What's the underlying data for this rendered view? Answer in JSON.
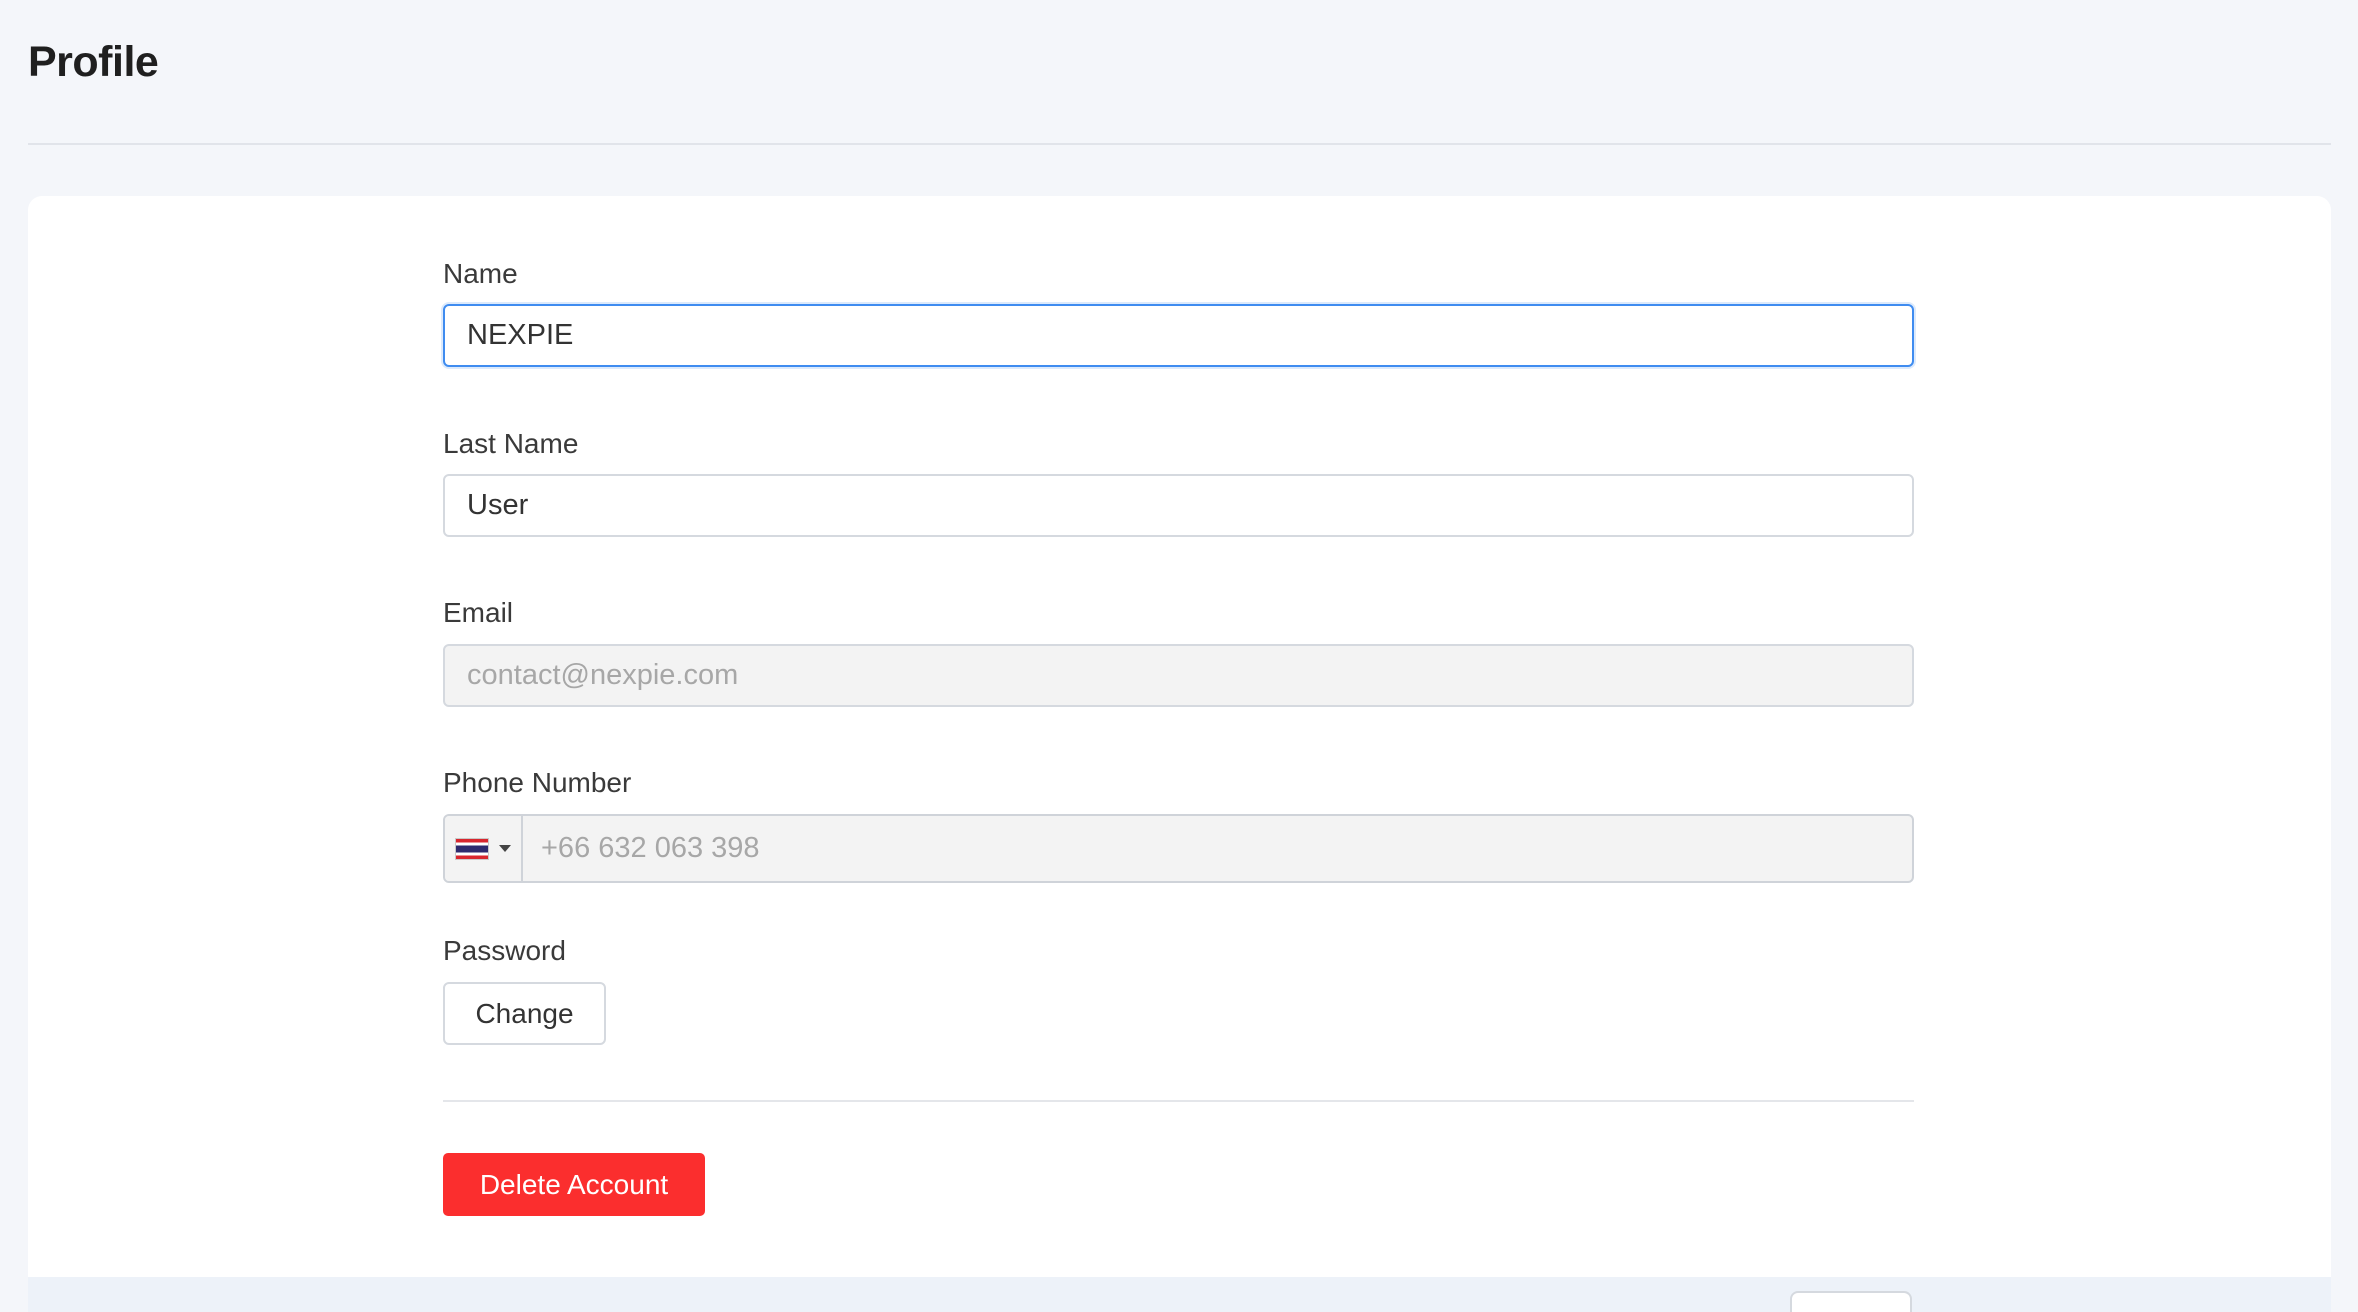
{
  "page": {
    "title": "Profile"
  },
  "form": {
    "name": {
      "label": "Name",
      "value": "NEXPIE"
    },
    "last_name": {
      "label": "Last Name",
      "value": "User"
    },
    "email": {
      "label": "Email",
      "value": "contact@nexpie.com"
    },
    "phone": {
      "label": "Phone Number",
      "country_flag": "thailand-flag-icon",
      "value": "+66 632 063 398"
    },
    "password": {
      "label": "Password",
      "change_label": "Change"
    },
    "delete_label": "Delete Account"
  },
  "colors": {
    "background": "#f4f6fa",
    "focus_border": "#3f8cf0",
    "danger": "#fb2e2e",
    "disabled_bg": "#f3f3f3"
  }
}
